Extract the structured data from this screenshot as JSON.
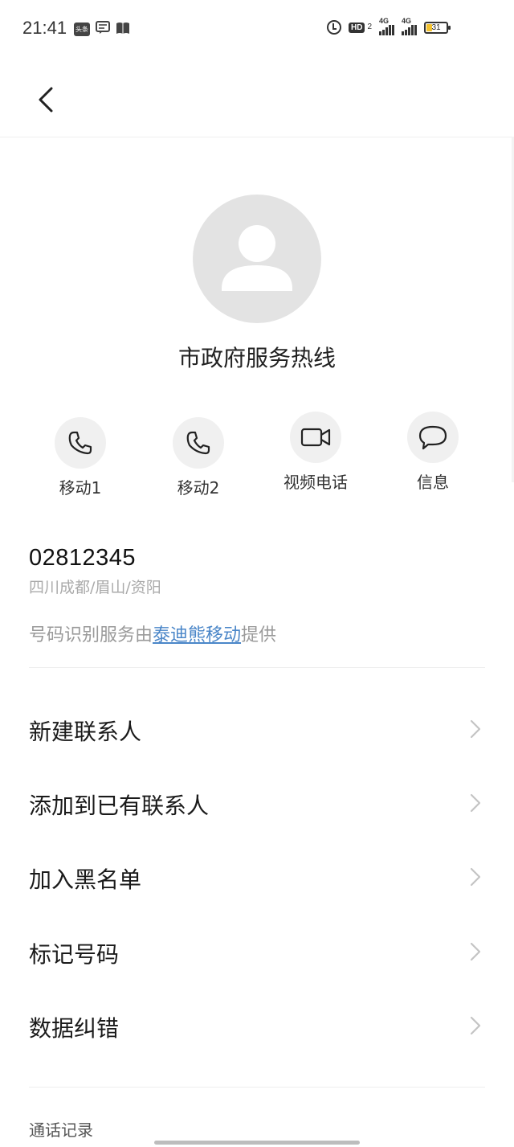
{
  "status_bar": {
    "time": "21:41",
    "left_icons": [
      "toutiao-icon",
      "message-box-icon",
      "book-icon"
    ],
    "toutiao_text": "头条",
    "hd_label": "HD",
    "hd_sub": "2",
    "sim1_network": "4G",
    "sim2_network": "4G",
    "battery_level": "31"
  },
  "header": {
    "back_icon": "chevron-left-icon"
  },
  "contact": {
    "name": "市政府服务热线",
    "avatar_icon": "person-placeholder-icon"
  },
  "actions": [
    {
      "label": "移动1",
      "icon": "phone-icon"
    },
    {
      "label": "移动2",
      "icon": "phone-icon"
    },
    {
      "label": "视频电话",
      "icon": "video-camera-icon"
    },
    {
      "label": "信息",
      "icon": "message-bubble-icon"
    }
  ],
  "number_info": {
    "number": "02812345",
    "location": "四川成都/眉山/资阳",
    "provider_prefix": "号码识别服务由",
    "provider_link": "泰迪熊移动",
    "provider_suffix": "提供"
  },
  "menu": [
    {
      "label": "新建联系人"
    },
    {
      "label": "添加到已有联系人"
    },
    {
      "label": "加入黑名单"
    },
    {
      "label": "标记号码"
    },
    {
      "label": "数据纠错"
    }
  ],
  "call_log": {
    "title": "通话记录"
  },
  "colors": {
    "link": "#4a86c8",
    "avatar_bg": "#e3e3e3",
    "action_bg": "#f0f0f0",
    "secondary_text": "#aaaaaa"
  }
}
